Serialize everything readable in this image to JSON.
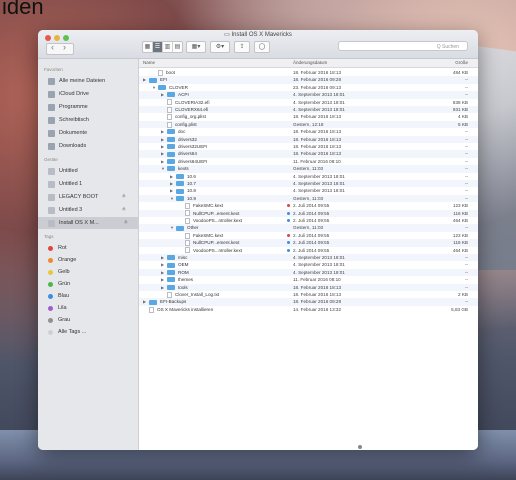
{
  "screen_fragment": "iden",
  "window": {
    "title": "Install OS X Mavericks",
    "search_placeholder": "Q Suchen"
  },
  "sidebar": {
    "favorites_header": "Favoriten",
    "favorites": [
      {
        "label": "Alle meine Dateien",
        "icon": "all-files-icon"
      },
      {
        "label": "iCloud Drive",
        "icon": "cloud-icon"
      },
      {
        "label": "Programme",
        "icon": "apps-icon"
      },
      {
        "label": "Schreibtisch",
        "icon": "desktop-icon"
      },
      {
        "label": "Dokumente",
        "icon": "documents-icon"
      },
      {
        "label": "Downloads",
        "icon": "downloads-icon"
      }
    ],
    "devices_header": "Geräte",
    "devices": [
      {
        "label": "Untitled",
        "eject": ""
      },
      {
        "label": "Untitled 1",
        "eject": ""
      },
      {
        "label": "LEGACY BOOT",
        "eject": "≜"
      },
      {
        "label": "Untitled 3",
        "eject": "≜"
      },
      {
        "label": "Install OS X M...",
        "eject": "≜",
        "selected": true
      }
    ],
    "tags_header": "Tags",
    "tags": [
      {
        "label": "Rot",
        "color": "#e2443d"
      },
      {
        "label": "Orange",
        "color": "#f08a2c"
      },
      {
        "label": "Gelb",
        "color": "#e9c73b"
      },
      {
        "label": "Grün",
        "color": "#4db74a"
      },
      {
        "label": "Blau",
        "color": "#3a8fe0"
      },
      {
        "label": "Lila",
        "color": "#a35bc9"
      },
      {
        "label": "Grau",
        "color": "#8f8f95"
      },
      {
        "label": "Alle Tags ...",
        "color": "#cfd0d4"
      }
    ]
  },
  "columns": {
    "name": "Name",
    "date": "Änderungsdatum",
    "size": "Größe"
  },
  "rows": [
    {
      "name": "boot",
      "depth": 1,
      "kind": "doc",
      "date": "18. Februar 2016 18:13",
      "size": "484 KB"
    },
    {
      "name": "EFI",
      "depth": 0,
      "kind": "folder",
      "open": false,
      "date": "18. Februar 2016 09:28",
      "size": "--"
    },
    {
      "name": "CLOVER",
      "depth": 1,
      "kind": "folder",
      "open": true,
      "date": "23. Februar 2016 09:13",
      "size": "--"
    },
    {
      "name": "ACPI",
      "depth": 2,
      "kind": "folder",
      "open": false,
      "date": "4. September 2013 18:01",
      "size": "--"
    },
    {
      "name": "CLOVERIA32.efi",
      "depth": 2,
      "kind": "doc",
      "date": "4. September 2013 18:01",
      "size": "838 KB"
    },
    {
      "name": "CLOVERX64.efi",
      "depth": 2,
      "kind": "doc",
      "date": "4. September 2013 18:01",
      "size": "931 KB"
    },
    {
      "name": "config_org.plist",
      "depth": 2,
      "kind": "doc",
      "date": "18. Februar 2016 18:13",
      "size": "4 KB"
    },
    {
      "name": "config.plist",
      "depth": 2,
      "kind": "doc",
      "date": "Gestern, 12:18",
      "size": "5 KB"
    },
    {
      "name": "doc",
      "depth": 2,
      "kind": "folder",
      "open": false,
      "date": "18. Februar 2016 18:13",
      "size": "--"
    },
    {
      "name": "drivers32",
      "depth": 2,
      "kind": "folder",
      "open": false,
      "date": "18. Februar 2016 18:13",
      "size": "--"
    },
    {
      "name": "drivers32UEFI",
      "depth": 2,
      "kind": "folder",
      "open": false,
      "date": "18. Februar 2016 18:13",
      "size": "--"
    },
    {
      "name": "drivers64",
      "depth": 2,
      "kind": "folder",
      "open": false,
      "date": "18. Februar 2016 18:13",
      "size": "--"
    },
    {
      "name": "drivers64UEFI",
      "depth": 2,
      "kind": "folder",
      "open": false,
      "date": "11. Februar 2016 08:10",
      "size": "--"
    },
    {
      "name": "kexts",
      "depth": 2,
      "kind": "folder",
      "open": true,
      "date": "Gestern, 11:03",
      "size": "--"
    },
    {
      "name": "10.6",
      "depth": 3,
      "kind": "folder",
      "open": false,
      "date": "4. September 2013 18:01",
      "size": "--"
    },
    {
      "name": "10.7",
      "depth": 3,
      "kind": "folder",
      "open": false,
      "date": "4. September 2013 18:01",
      "size": "--"
    },
    {
      "name": "10.8",
      "depth": 3,
      "kind": "folder",
      "open": false,
      "date": "4. September 2013 18:01",
      "size": "--"
    },
    {
      "name": "10.9",
      "depth": 3,
      "kind": "folder",
      "open": true,
      "date": "Gestern, 11:03",
      "size": "--"
    },
    {
      "name": "FakeSMC.kext",
      "depth": 4,
      "kind": "doc",
      "tag": "#e2443d",
      "date": "2. Juli 2014 09:55",
      "size": "123 KB"
    },
    {
      "name": "NullCPUP...ement.kext",
      "depth": 4,
      "kind": "doc",
      "tag": "#3a8fe0",
      "date": "2. Juli 2014 09:55",
      "size": "116 KB"
    },
    {
      "name": "VoodooPS...ntroller.kext",
      "depth": 4,
      "kind": "doc",
      "tag": "#3a8fe0",
      "date": "2. Juli 2014 09:55",
      "size": "464 KB"
    },
    {
      "name": "Other",
      "depth": 3,
      "kind": "folder",
      "open": true,
      "date": "Gestern, 11:03",
      "size": "--"
    },
    {
      "name": "FakeSMC.kext",
      "depth": 4,
      "kind": "doc",
      "tag": "#e2443d",
      "date": "2. Juli 2014 09:55",
      "size": "123 KB"
    },
    {
      "name": "NullCPUP...ement.kext",
      "depth": 4,
      "kind": "doc",
      "tag": "#3a8fe0",
      "date": "2. Juli 2014 09:55",
      "size": "116 KB"
    },
    {
      "name": "VoodooPS...ntroller.kext",
      "depth": 4,
      "kind": "doc",
      "tag": "#3a8fe0",
      "date": "2. Juli 2014 09:55",
      "size": "464 KB"
    },
    {
      "name": "misc",
      "depth": 2,
      "kind": "folder",
      "open": false,
      "date": "4. September 2013 18:01",
      "size": "--"
    },
    {
      "name": "OEM",
      "depth": 2,
      "kind": "folder",
      "open": false,
      "date": "4. September 2013 18:01",
      "size": "--"
    },
    {
      "name": "ROM",
      "depth": 2,
      "kind": "folder",
      "open": false,
      "date": "4. September 2013 18:01",
      "size": "--"
    },
    {
      "name": "themes",
      "depth": 2,
      "kind": "folder",
      "open": false,
      "date": "11. Februar 2016 08:10",
      "size": "--"
    },
    {
      "name": "tools",
      "depth": 2,
      "kind": "folder",
      "open": false,
      "date": "18. Februar 2016 18:13",
      "size": "--"
    },
    {
      "name": "Clover_Install_Log.txt",
      "depth": 2,
      "kind": "doc",
      "date": "18. Februar 2016 18:13",
      "size": "2 KB"
    },
    {
      "name": "EFI-Backups",
      "depth": 0,
      "kind": "folder",
      "open": false,
      "date": "18. Februar 2016 09:28",
      "size": "--"
    },
    {
      "name": "OS X Mavericks installieren",
      "depth": 0,
      "kind": "doc",
      "date": "14. Februar 2016 13:32",
      "size": "5,83 GB"
    }
  ]
}
